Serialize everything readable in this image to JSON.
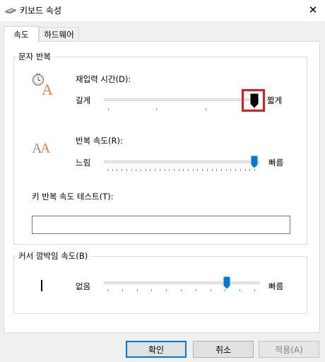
{
  "window": {
    "title": "키보드 속성",
    "close_glyph": "✕"
  },
  "tabs": [
    {
      "label": "속도",
      "selected": true
    },
    {
      "label": "하드웨어",
      "selected": false
    }
  ],
  "char_repeat": {
    "group_label": "문자 반복",
    "delay": {
      "label": "재입력 시간(D):",
      "min_label": "길게",
      "max_label": "짧게",
      "value_fraction": 1.0
    },
    "rate": {
      "label": "반복 속도(R):",
      "min_label": "느림",
      "max_label": "빠름",
      "value_fraction": 1.0
    },
    "test": {
      "label": "키 반복 속도 테스트(T):",
      "value": ""
    }
  },
  "cursor_blink": {
    "group_label": "커서 깜박임 속도(B)",
    "min_label": "없음",
    "max_label": "빠름",
    "value_fraction": 0.8
  },
  "buttons": {
    "ok": "확인",
    "cancel": "취소",
    "apply": "적용(A)"
  },
  "icons": {
    "title": "keyboard-icon",
    "delay": "clock-letter-a-icon",
    "rate": "double-letter-a-icon",
    "close": "close-icon"
  },
  "colors": {
    "accent": "#0078d7",
    "highlight": "#e51b1b",
    "disabled_text": "#838383"
  }
}
